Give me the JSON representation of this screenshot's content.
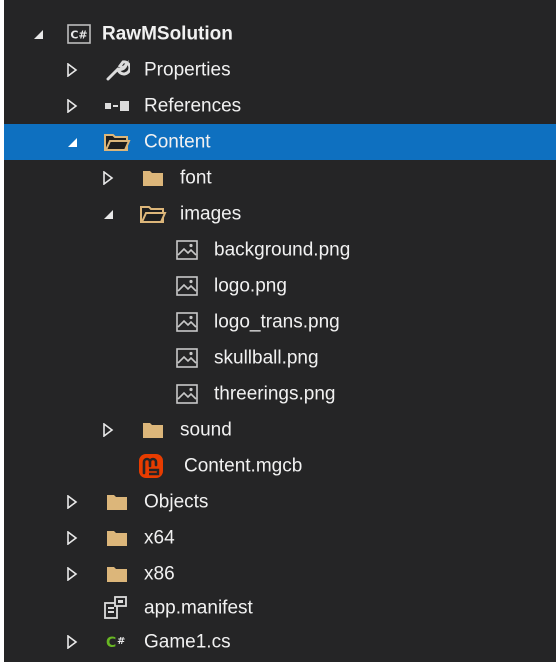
{
  "solution_explorer": {
    "rows": [
      {
        "label": "RawMSolution",
        "icon": "csharp-project-icon",
        "expander": "expanded"
      },
      {
        "label": "Properties",
        "icon": "wrench-icon",
        "expander": "collapsed"
      },
      {
        "label": "References",
        "icon": "references-icon",
        "expander": "collapsed"
      },
      {
        "label": "Content",
        "icon": "folder-open-icon",
        "expander": "expanded",
        "selected": true
      },
      {
        "label": "font",
        "icon": "folder-icon",
        "expander": "collapsed"
      },
      {
        "label": "images",
        "icon": "folder-open-icon",
        "expander": "expanded"
      },
      {
        "label": "background.png",
        "icon": "image-file-icon"
      },
      {
        "label": "logo.png",
        "icon": "image-file-icon"
      },
      {
        "label": "logo_trans.png",
        "icon": "image-file-icon"
      },
      {
        "label": "skullball.png",
        "icon": "image-file-icon"
      },
      {
        "label": "threerings.png",
        "icon": "image-file-icon"
      },
      {
        "label": "sound",
        "icon": "folder-icon",
        "expander": "collapsed"
      },
      {
        "label": "Content.mgcb",
        "icon": "monogame-icon"
      },
      {
        "label": "Objects",
        "icon": "folder-icon",
        "expander": "collapsed"
      },
      {
        "label": "x64",
        "icon": "folder-icon",
        "expander": "collapsed"
      },
      {
        "label": "x86",
        "icon": "folder-icon",
        "expander": "collapsed"
      },
      {
        "label": "app.manifest",
        "icon": "manifest-icon"
      },
      {
        "label": "Game1.cs",
        "icon": "csharp-file-icon",
        "expander": "collapsed"
      }
    ],
    "colors": {
      "background": "#252526",
      "selection": "#0e70c0",
      "text": "#f1f1f1",
      "folder": "#dcb67a",
      "monogame": "#e73c00",
      "csharp_green": "#68b723"
    }
  }
}
